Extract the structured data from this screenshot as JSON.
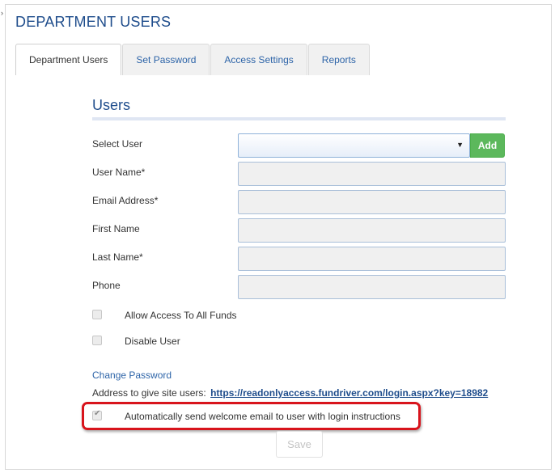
{
  "page": {
    "title": "DEPARTMENT USERS"
  },
  "tabs": [
    {
      "label": "Department Users",
      "active": true
    },
    {
      "label": "Set Password",
      "active": false
    },
    {
      "label": "Access Settings",
      "active": false
    },
    {
      "label": "Reports",
      "active": false
    }
  ],
  "section": {
    "title": "Users"
  },
  "form": {
    "select_user": {
      "label": "Select User",
      "value": "",
      "add_label": "Add"
    },
    "user_name": {
      "label": "User Name*",
      "value": ""
    },
    "email": {
      "label": "Email Address*",
      "value": ""
    },
    "first_name": {
      "label": "First Name",
      "value": ""
    },
    "last_name": {
      "label": "Last Name*",
      "value": ""
    },
    "phone": {
      "label": "Phone",
      "value": ""
    },
    "allow_all_funds": {
      "label": "Allow Access To All Funds",
      "checked": false
    },
    "disable_user": {
      "label": "Disable User",
      "checked": false
    },
    "change_password_link": "Change Password",
    "address_label": "Address to give site users:",
    "address_url": "https://readonlyaccess.fundriver.com/login.aspx?key=18982",
    "welcome_email": {
      "label": "Automatically send welcome email to user with login instructions",
      "checked": true
    },
    "save_label": "Save"
  },
  "colors": {
    "title_blue": "#1f4d8c",
    "link_blue": "#2d64a8",
    "add_green": "#5cb85c",
    "highlight_red": "#d8141c"
  },
  "icons": {
    "dropdown": "triangle-down",
    "welcome_checkbox": "check-mark"
  }
}
